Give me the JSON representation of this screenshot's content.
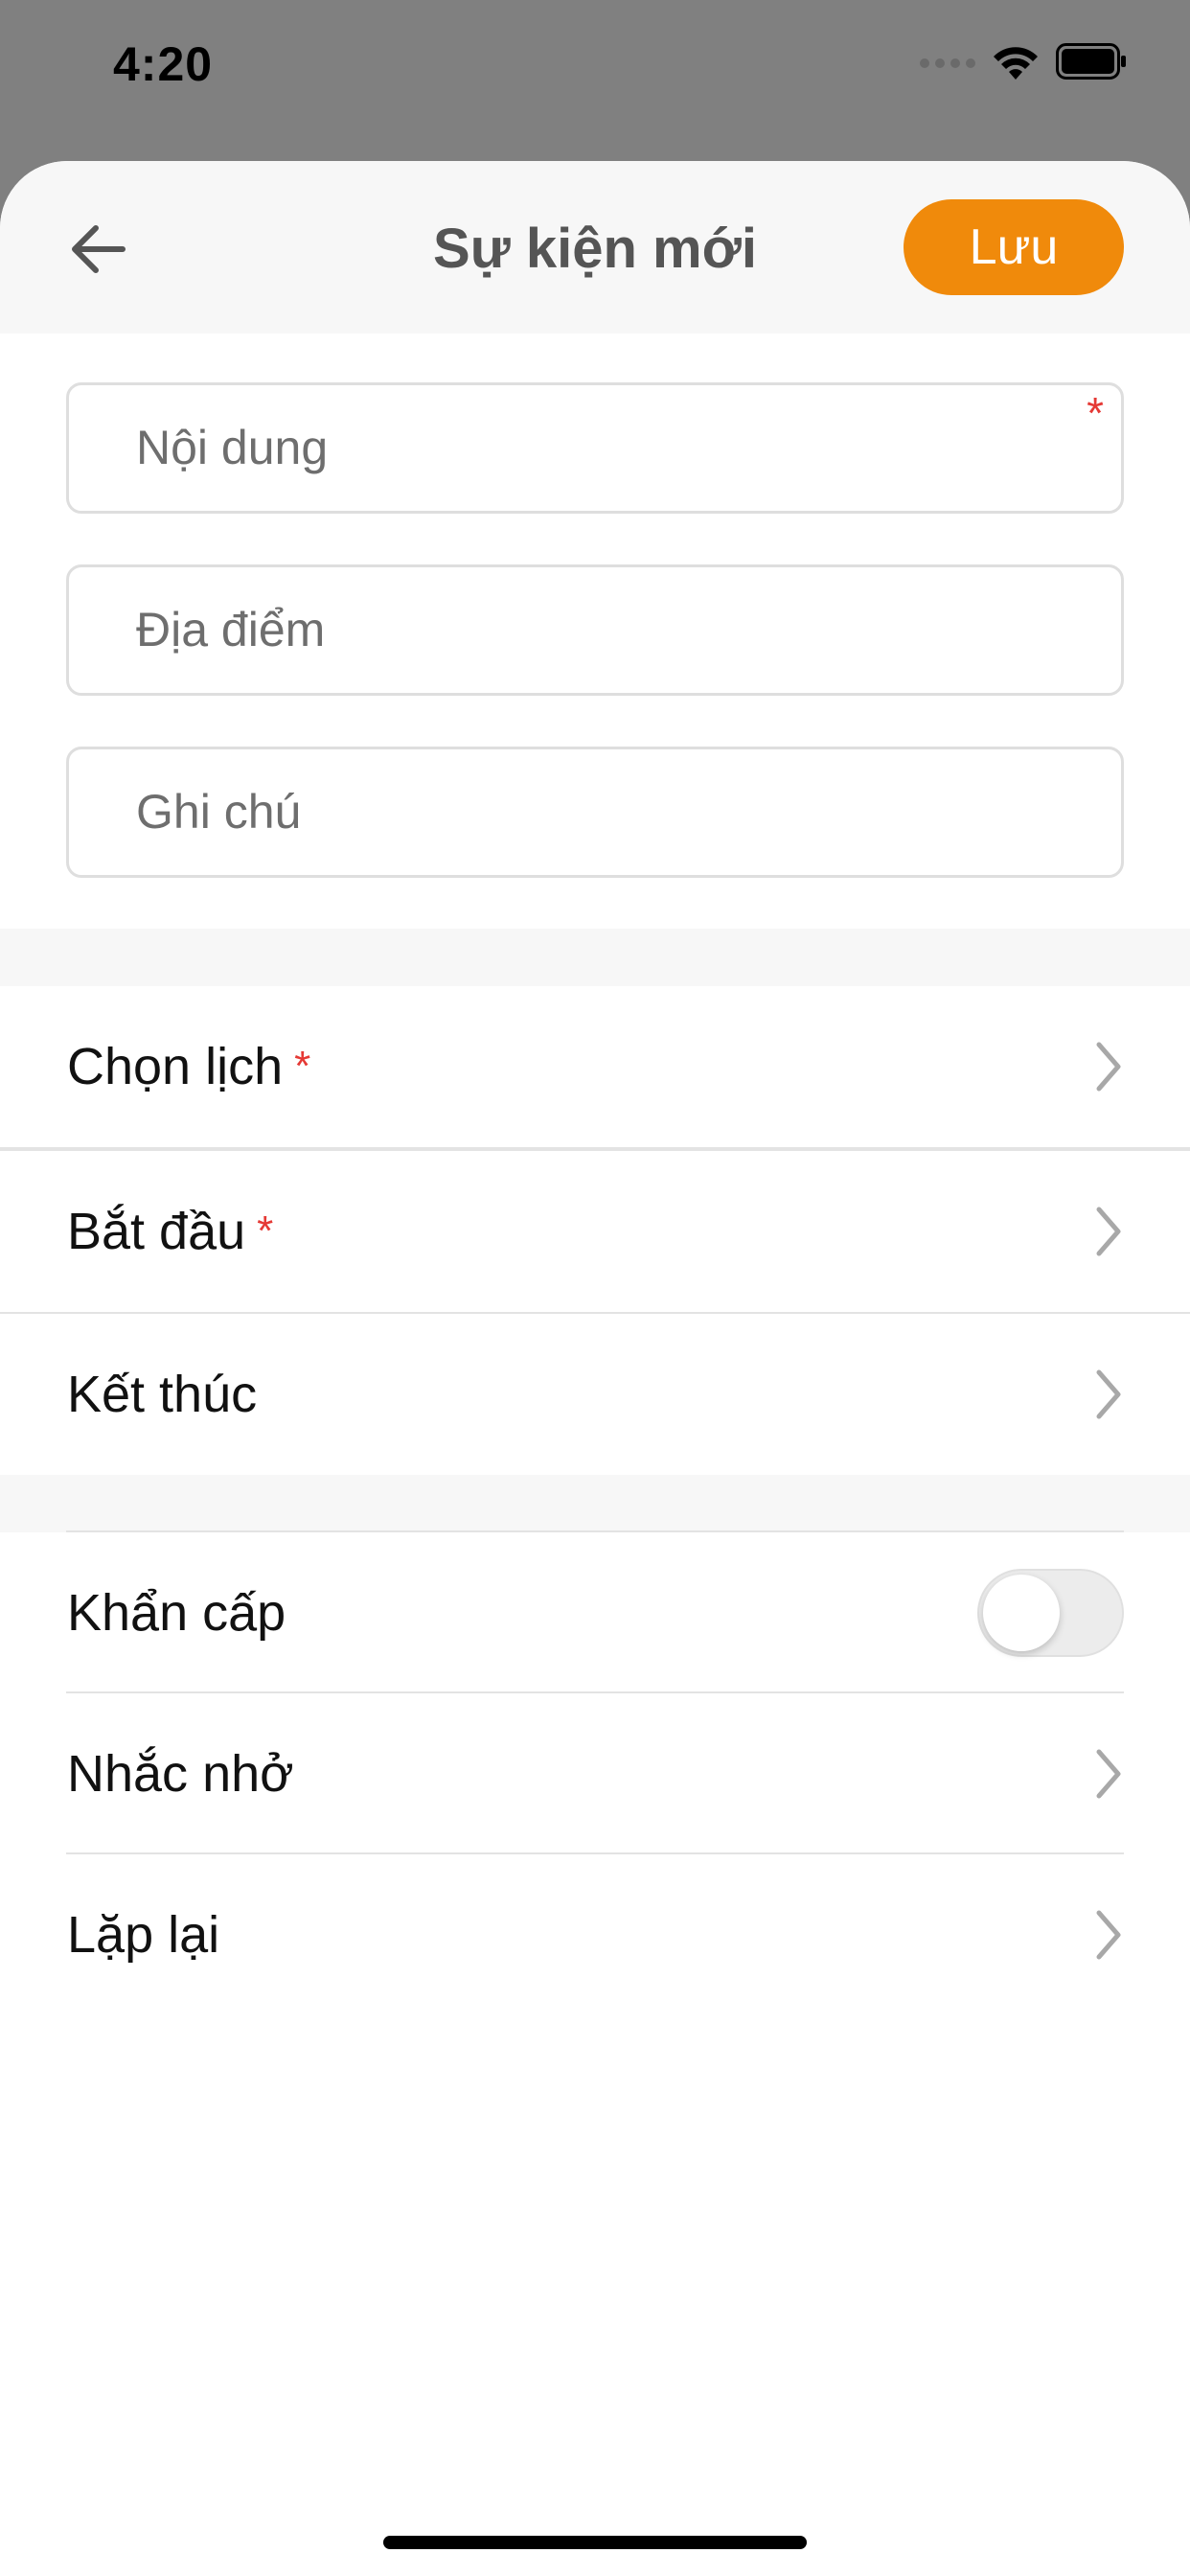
{
  "status_bar": {
    "time": "4:20"
  },
  "header": {
    "title": "Sự kiện mới",
    "save_label": "Lưu",
    "back_icon": "arrow-left-icon"
  },
  "form": {
    "content": {
      "placeholder": "Nội dung",
      "value": "",
      "required": "*"
    },
    "location": {
      "placeholder": "Địa điểm",
      "value": ""
    },
    "note": {
      "placeholder": "Ghi chú",
      "value": ""
    }
  },
  "rows": {
    "calendar": {
      "label": "Chọn lịch",
      "required": "*"
    },
    "start": {
      "label": "Bắt đầu",
      "required": "*"
    },
    "end": {
      "label": "Kết thúc"
    },
    "urgent": {
      "label": "Khẩn cấp",
      "toggle_on": false
    },
    "reminder": {
      "label": "Nhắc nhở"
    },
    "repeat": {
      "label": "Lặp lại"
    }
  },
  "colors": {
    "accent": "#f08a0b",
    "required": "#e53935"
  }
}
